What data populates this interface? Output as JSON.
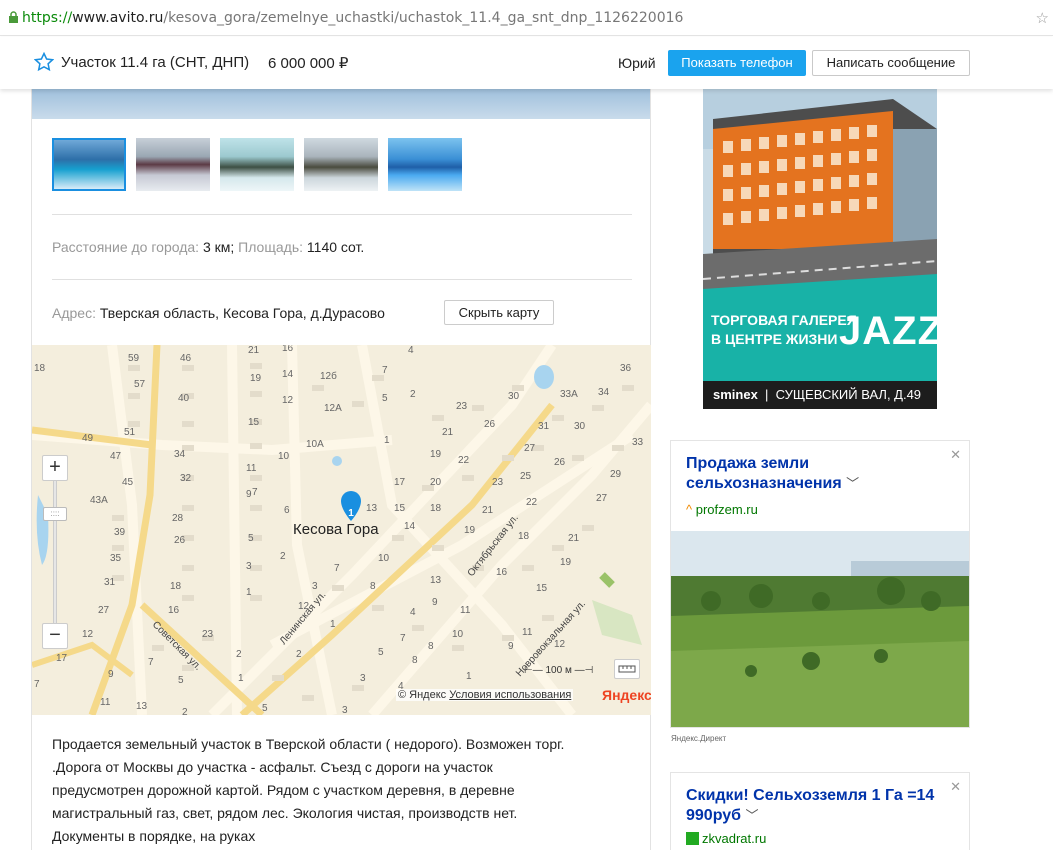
{
  "browser": {
    "url_protocol": "https://",
    "url_host": "www.avito.ru",
    "url_path": "/kesova_gora/zemelnye_uchastki/uchastok_11.4_ga_snt_dnp_1126220016"
  },
  "header": {
    "title": "Участок 11.4 га (СНТ, ДНП)",
    "price": "6 000 000 ₽",
    "seller_name": "Юрий",
    "show_phone_label": "Показать телефон",
    "write_message_label": "Написать сообщение"
  },
  "listing": {
    "params": {
      "distance_label": "Расстояние до города:",
      "distance_value": "3 км;",
      "area_label": "Площадь:",
      "area_value": "1140 сот."
    },
    "address_label": "Адрес:",
    "address_value": "Тверская область, Кесова Гора, д.Дурасово",
    "hide_map_label": "Скрыть карту",
    "description": [
      "Продается земельный участок в Тверской области ( недорого). Возможен торг.",
      ".Дорога от Москвы до участка - асфальт. Съезд с дороги на участок",
      "предусмотрен дорожной картой. Рядом с участком деревня, в деревне",
      "магистральный газ, свет, рядом лес. Экология чистая, производств нет.",
      "Документы в порядке, на руках"
    ]
  },
  "map": {
    "place_label": "Кесова Гора",
    "marker_number": "1",
    "streets": [
      "Ленинская ул.",
      "Октябрьская ул.",
      "Новровокзальная ул.",
      "Советская ул."
    ],
    "zoom_in": "+",
    "zoom_out": "−",
    "scale_label": "100 м",
    "copyright": "© Яндекс",
    "terms_link": "Условия использования",
    "logo": "Яндекс",
    "house_numbers": [
      "59",
      "46",
      "21",
      "16",
      "4",
      "18",
      "57",
      "19",
      "14",
      "12б",
      "7",
      "36",
      "40",
      "12",
      "12А",
      "5",
      "2",
      "23",
      "30",
      "33А",
      "34",
      "49",
      "51",
      "15",
      "10А",
      "1",
      "21",
      "26",
      "31",
      "30",
      "47",
      "34",
      "11",
      "10",
      "19",
      "22",
      "27",
      "26",
      "33",
      "45",
      "32",
      "7",
      "17",
      "20",
      "23",
      "25",
      "29",
      "43А",
      "28",
      "9",
      "6",
      "13",
      "15",
      "18",
      "21",
      "22",
      "27",
      "39",
      "26",
      "5",
      "14",
      "19",
      "18",
      "21",
      "35",
      "3",
      "2",
      "7",
      "10",
      "16",
      "19",
      "31",
      "18",
      "1",
      "3",
      "8",
      "13",
      "15",
      "27",
      "16",
      "12",
      "1",
      "4",
      "9",
      "11",
      "12",
      "23",
      "8",
      "7",
      "10",
      "11",
      "17",
      "2",
      "2",
      "5",
      "8",
      "9",
      "12",
      "9",
      "7",
      "5",
      "1",
      "3",
      "4",
      "1",
      "7",
      "11",
      "13",
      "2",
      "5",
      "3"
    ]
  },
  "sidebar": {
    "banner": {
      "caption_line1": "ТОРГОВАЯ ГАЛЕРЕЯ",
      "caption_line2": "В ЦЕНТРЕ ЖИЗНИ",
      "caption_big": "JAZZ",
      "brand": "sminex",
      "address": "СУЩЕВСКИЙ ВАЛ, Д.49"
    },
    "ad1": {
      "title": "Продажа земли сельхозназначения",
      "domain": "profzem.ru"
    },
    "direct_label": "Яндекс.Директ",
    "ad2": {
      "title": "Скидки! Сельхозземля 1 Га =14 990руб",
      "domain": "zkvadrat.ru"
    }
  }
}
